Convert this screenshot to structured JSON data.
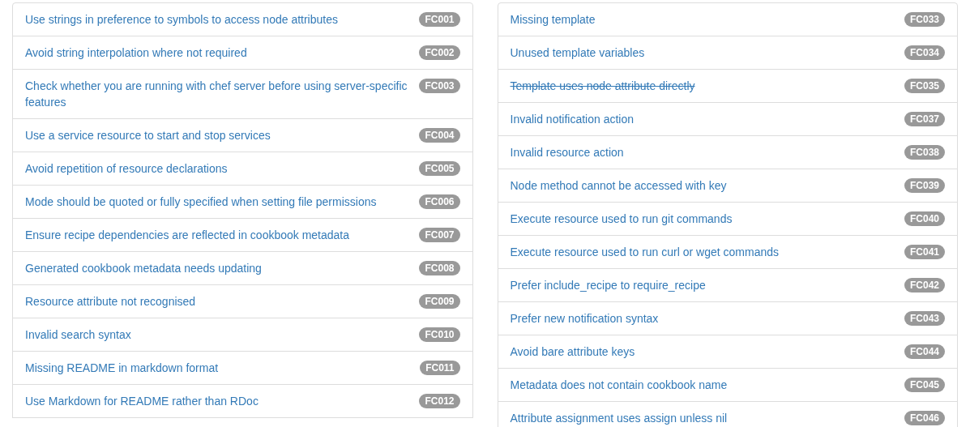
{
  "columns": [
    {
      "items": [
        {
          "label": "Use strings in preference to symbols to access node attributes",
          "code": "FC001",
          "deprecated": false
        },
        {
          "label": "Avoid string interpolation where not required",
          "code": "FC002",
          "deprecated": false
        },
        {
          "label": "Check whether you are running with chef server before using server-specific features",
          "code": "FC003",
          "deprecated": false
        },
        {
          "label": "Use a service resource to start and stop services",
          "code": "FC004",
          "deprecated": false
        },
        {
          "label": "Avoid repetition of resource declarations",
          "code": "FC005",
          "deprecated": false
        },
        {
          "label": "Mode should be quoted or fully specified when setting file permissions",
          "code": "FC006",
          "deprecated": false
        },
        {
          "label": "Ensure recipe dependencies are reflected in cookbook metadata",
          "code": "FC007",
          "deprecated": false
        },
        {
          "label": "Generated cookbook metadata needs updating",
          "code": "FC008",
          "deprecated": false
        },
        {
          "label": "Resource attribute not recognised",
          "code": "FC009",
          "deprecated": false
        },
        {
          "label": "Invalid search syntax",
          "code": "FC010",
          "deprecated": false
        },
        {
          "label": "Missing README in markdown format",
          "code": "FC011",
          "deprecated": false
        },
        {
          "label": "Use Markdown for README rather than RDoc",
          "code": "FC012",
          "deprecated": false
        }
      ]
    },
    {
      "items": [
        {
          "label": "Missing template",
          "code": "FC033",
          "deprecated": false
        },
        {
          "label": "Unused template variables",
          "code": "FC034",
          "deprecated": false
        },
        {
          "label": "Template uses node attribute directly",
          "code": "FC035",
          "deprecated": true
        },
        {
          "label": "Invalid notification action",
          "code": "FC037",
          "deprecated": false
        },
        {
          "label": "Invalid resource action",
          "code": "FC038",
          "deprecated": false
        },
        {
          "label": "Node method cannot be accessed with key",
          "code": "FC039",
          "deprecated": false
        },
        {
          "label": "Execute resource used to run git commands",
          "code": "FC040",
          "deprecated": false
        },
        {
          "label": "Execute resource used to run curl or wget commands",
          "code": "FC041",
          "deprecated": false
        },
        {
          "label": "Prefer include_recipe to require_recipe",
          "code": "FC042",
          "deprecated": false
        },
        {
          "label": "Prefer new notification syntax",
          "code": "FC043",
          "deprecated": false
        },
        {
          "label": "Avoid bare attribute keys",
          "code": "FC044",
          "deprecated": false
        },
        {
          "label": "Metadata does not contain cookbook name",
          "code": "FC045",
          "deprecated": false
        },
        {
          "label": "Attribute assignment uses assign unless nil",
          "code": "FC046",
          "deprecated": false
        }
      ]
    }
  ]
}
